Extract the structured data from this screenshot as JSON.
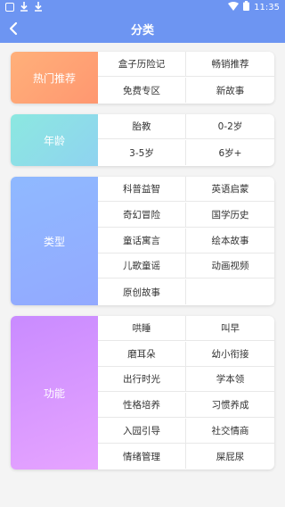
{
  "status_bar": {
    "time": "11:35",
    "icons": [
      "app-icon",
      "download-icon",
      "download-icon",
      "wifi-icon",
      "battery-icon"
    ]
  },
  "header": {
    "title": "分类",
    "back_icon": "chevron-left-icon"
  },
  "sections": [
    {
      "id": "hot",
      "label": "热门推荐",
      "accent": "#ff9a72",
      "items": [
        "盒子历险记",
        "畅销推荐",
        "免费专区",
        "新故事"
      ]
    },
    {
      "id": "age",
      "label": "年龄",
      "accent": "#8ce0e6",
      "items": [
        "胎教",
        "0-2岁",
        "3-5岁",
        "6岁+"
      ]
    },
    {
      "id": "type",
      "label": "类型",
      "accent": "#90b0ff",
      "items": [
        "科普益智",
        "英语启蒙",
        "奇幻冒险",
        "国学历史",
        "童话寓言",
        "绘本故事",
        "儿歌童谣",
        "动画视频",
        "原创故事",
        ""
      ]
    },
    {
      "id": "func",
      "label": "功能",
      "accent": "#d495ff",
      "items": [
        "哄睡",
        "叫早",
        "磨耳朵",
        "幼小衔接",
        "出行时光",
        "学本领",
        "性格培养",
        "习惯养成",
        "入园引导",
        "社交情商",
        "情绪管理",
        "屎屁尿"
      ]
    }
  ]
}
